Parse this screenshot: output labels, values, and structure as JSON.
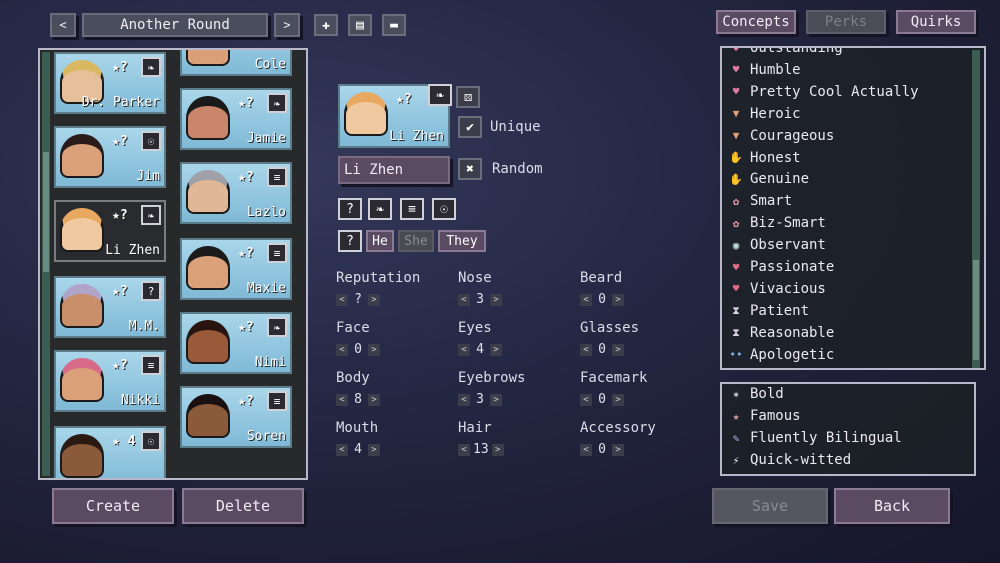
{
  "header": {
    "prev_arrow": "<",
    "next_arrow": ">",
    "title": "Another Round"
  },
  "roster": [
    {
      "name": "Dr. Parker",
      "stars": "★?",
      "badge": "feather-icon",
      "badge_glyph": "❧",
      "skin": "#e6c09a",
      "hair": "#d8b860"
    },
    {
      "name": "Jim",
      "stars": "★?",
      "badge": "lightbulb-icon",
      "badge_glyph": "☉",
      "skin": "#d9a07a",
      "hair": "#2a1a1a"
    },
    {
      "name": "Li Zhen",
      "stars": "★?",
      "badge": "feather-icon",
      "badge_glyph": "❧",
      "skin": "#f0c9a0",
      "hair": "#e8a860"
    },
    {
      "name": "M.M.",
      "stars": "★?",
      "badge": "question-icon",
      "badge_glyph": "?",
      "skin": "#c98e6a",
      "hair": "#b0a4c8"
    },
    {
      "name": "Nikki",
      "stars": "★?",
      "badge": "document-icon",
      "badge_glyph": "≡",
      "skin": "#d9a07a",
      "hair": "#d86a8a"
    },
    {
      "name": "",
      "stars": "★ 4",
      "badge": "lightbulb-icon",
      "badge_glyph": "☉",
      "skin": "#8a5a3a",
      "hair": "#2a1a12"
    },
    {
      "name": "Cole",
      "stars": "",
      "badge": "",
      "badge_glyph": "",
      "skin": "#d9a07a",
      "hair": "#5a3a22"
    },
    {
      "name": "Jamie",
      "stars": "★?",
      "badge": "feather-icon",
      "badge_glyph": "❧",
      "skin": "#c9866a",
      "hair": "#1a1a1a"
    },
    {
      "name": "Lazlo",
      "stars": "★?",
      "badge": "document-icon",
      "badge_glyph": "≡",
      "skin": "#e0b898",
      "hair": "#a0a0a8"
    },
    {
      "name": "Maxie",
      "stars": "★?",
      "badge": "document-icon",
      "badge_glyph": "≡",
      "skin": "#d9a07a",
      "hair": "#1a1a1a"
    },
    {
      "name": "Nimi",
      "stars": "★?",
      "badge": "feather-icon",
      "badge_glyph": "❧",
      "skin": "#9a5a3a",
      "hair": "#2a1410"
    },
    {
      "name": "Soren",
      "stars": "★?",
      "badge": "document-icon",
      "badge_glyph": "≡",
      "skin": "#8a5a3a",
      "hair": "#1a1010"
    }
  ],
  "buttons": {
    "create": "Create",
    "delete": "Delete",
    "save": "Save",
    "back": "Back"
  },
  "editor": {
    "preview_name": "Li Zhen",
    "preview_stars": "★?",
    "unique_label": "Unique",
    "random_label": "Random",
    "name_value": "Li Zhen",
    "check_glyph": "✔",
    "x_glyph": "✖",
    "dice_glyph": "⚄",
    "role_icons": [
      "?",
      "❧",
      "≡",
      "☉"
    ],
    "pronoun_question": "?",
    "pronouns": [
      "He",
      "She",
      "They"
    ],
    "selected_pronoun": "She"
  },
  "attributes": [
    {
      "label": "Reputation",
      "value": "?"
    },
    {
      "label": "Nose",
      "value": "3"
    },
    {
      "label": "Beard",
      "value": "0"
    },
    {
      "label": "Face",
      "value": "0"
    },
    {
      "label": "Eyes",
      "value": "4"
    },
    {
      "label": "Glasses",
      "value": "0"
    },
    {
      "label": "Body",
      "value": "8"
    },
    {
      "label": "Eyebrows",
      "value": "3"
    },
    {
      "label": "Facemark",
      "value": "0"
    },
    {
      "label": "Mouth",
      "value": "4"
    },
    {
      "label": "Hair",
      "value": "13"
    },
    {
      "label": "Accessory",
      "value": "0"
    }
  ],
  "stepper": {
    "left": "<",
    "right": ">"
  },
  "tabs": {
    "concepts": "Concepts",
    "perks": "Perks",
    "quirks": "Quirks",
    "active": "Concepts"
  },
  "concepts": [
    {
      "label": "Outstanding",
      "icon": "heart-icon",
      "glyph": "♥",
      "color": "#e07aa0"
    },
    {
      "label": "Humble",
      "icon": "heart-icon",
      "glyph": "♥",
      "color": "#e07aa0"
    },
    {
      "label": "Pretty Cool Actually",
      "icon": "heart-icon",
      "glyph": "♥",
      "color": "#e07aa0"
    },
    {
      "label": "Heroic",
      "icon": "shield-icon",
      "glyph": "▼",
      "color": "#e0a07a"
    },
    {
      "label": "Courageous",
      "icon": "shield-icon",
      "glyph": "▼",
      "color": "#e0a07a"
    },
    {
      "label": "Honest",
      "icon": "hand-icon",
      "glyph": "✋",
      "color": "#e8c8b0"
    },
    {
      "label": "Genuine",
      "icon": "hand-icon",
      "glyph": "✋",
      "color": "#e8c8b0"
    },
    {
      "label": "Smart",
      "icon": "brain-icon",
      "glyph": "✿",
      "color": "#e89aa8"
    },
    {
      "label": "Biz-Smart",
      "icon": "brain-icon",
      "glyph": "✿",
      "color": "#e89aa8"
    },
    {
      "label": "Observant",
      "icon": "eye-icon",
      "glyph": "◉",
      "color": "#c0e0d8"
    },
    {
      "label": "Passionate",
      "icon": "heart-flame-icon",
      "glyph": "♥",
      "color": "#e06a8a"
    },
    {
      "label": "Vivacious",
      "icon": "heart-flame-icon",
      "glyph": "♥",
      "color": "#e06a8a"
    },
    {
      "label": "Patient",
      "icon": "hourglass-icon",
      "glyph": "⧗",
      "color": "#d8d0e0"
    },
    {
      "label": "Reasonable",
      "icon": "hourglass-icon",
      "glyph": "⧗",
      "color": "#d8d0e0"
    },
    {
      "label": "Apologetic",
      "icon": "tears-icon",
      "glyph": "••",
      "color": "#7ab0e8"
    }
  ],
  "quirks": [
    {
      "label": "Bold",
      "icon": "flame-icon",
      "glyph": "✶",
      "color": "#d8e8e8"
    },
    {
      "label": "Famous",
      "icon": "star-icon",
      "glyph": "★",
      "color": "#e0a0a8"
    },
    {
      "label": "Fluently Bilingual",
      "icon": "pen-icon",
      "glyph": "✎",
      "color": "#a8b8e8"
    },
    {
      "label": "Quick-witted",
      "icon": "lightning-icon",
      "glyph": "⚡",
      "color": "#f0f0f0"
    }
  ]
}
